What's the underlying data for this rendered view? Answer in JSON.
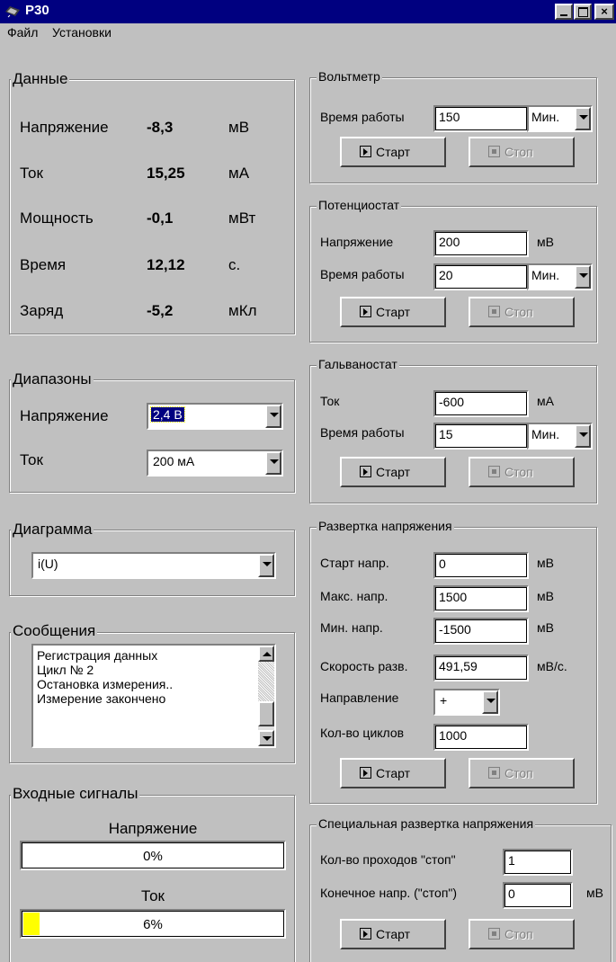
{
  "window": {
    "title": "P30"
  },
  "menu": [
    "Файл",
    "Установки"
  ],
  "data_group": {
    "title": "Данные",
    "rows": [
      {
        "label": "Напряжение",
        "value": "-8,3",
        "unit": "мВ"
      },
      {
        "label": "Ток",
        "value": "15,25",
        "unit": "мА"
      },
      {
        "label": "Мощность",
        "value": "-0,1",
        "unit": "мВт"
      },
      {
        "label": "Время",
        "value": "12,12",
        "unit": "с."
      },
      {
        "label": "Заряд",
        "value": "-5,2",
        "unit": "мКл"
      }
    ]
  },
  "ranges": {
    "title": "Диапазоны",
    "voltage_label": "Напряжение",
    "voltage_value": "2,4 В",
    "current_label": "Ток",
    "current_value": "200 мА"
  },
  "diagram": {
    "title": "Диаграмма",
    "value": "i(U)"
  },
  "messages": {
    "title": "Сообщения",
    "lines": [
      "Регистрация данных",
      "Цикл № 2",
      "Остановка измерения..",
      "Измерение закончено"
    ]
  },
  "inputs": {
    "title": "Входные сигналы",
    "voltage_label": "Напряжение",
    "voltage_text": "0%",
    "voltage_fraction": 0.0,
    "current_label": "Ток",
    "current_text": "6%",
    "current_fraction": 0.06
  },
  "buttons": {
    "start": "Старт",
    "stop": "Стоп"
  },
  "voltmeter": {
    "title": "Вольтметр",
    "time_label": "Время работы",
    "time_value": "150",
    "time_unit": "Мин."
  },
  "potentiostat": {
    "title": "Потенциостат",
    "voltage_label": "Напряжение",
    "voltage_value": "200",
    "voltage_unit": "мВ",
    "time_label": "Время работы",
    "time_value": "20",
    "time_unit": "Мин."
  },
  "galvanostat": {
    "title": "Гальваностат",
    "current_label": "Ток",
    "current_value": "-600",
    "current_unit": "мА",
    "time_label": "Время работы",
    "time_value": "15",
    "time_unit": "Мин."
  },
  "sweep": {
    "title": "Развертка напряжения",
    "start_label": "Старт напр.",
    "start_value": "0",
    "start_unit": "мВ",
    "max_label": "Макс. напр.",
    "max_value": "1500",
    "max_unit": "мВ",
    "min_label": "Мин. напр.",
    "min_value": "-1500",
    "min_unit": "мВ",
    "speed_label": "Скорость разв.",
    "speed_value": "491,59",
    "speed_unit": "мВ/с.",
    "dir_label": "Направление",
    "dir_value": "+",
    "cycles_label": "Кол-во циклов",
    "cycles_value": "1000"
  },
  "special": {
    "title": "Специальная развертка напряжения",
    "passes_label": "Кол-во проходов \"стоп\"",
    "passes_value": "1",
    "final_label": "Конечное напр. (\"стоп\")",
    "final_value": "0",
    "final_unit": "мВ"
  },
  "colors": {
    "title_bar": "#000080",
    "selection": "#000080",
    "progress": "#ffff00",
    "face": "#c0c0c0"
  }
}
